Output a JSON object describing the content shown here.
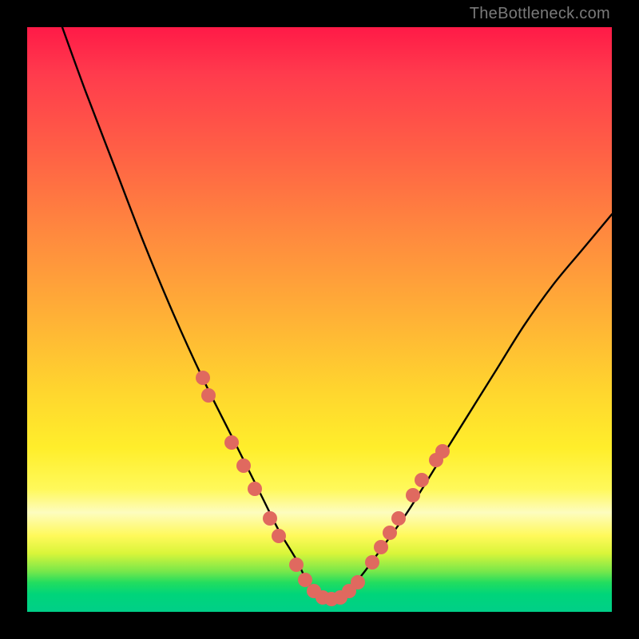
{
  "attribution": "TheBottleneck.com",
  "colors": {
    "frame": "#000000",
    "curve": "#000000",
    "marker": "#e0695f",
    "attribution_text": "#7a7a7a"
  },
  "chart_data": {
    "type": "line",
    "title": "",
    "xlabel": "",
    "ylabel": "",
    "xlim": [
      0,
      100
    ],
    "ylim": [
      0,
      100
    ],
    "grid": false,
    "legend": false,
    "note": "No axis ticks or labels are rendered; values are fractional positions (0–100) estimated from the plot geometry.",
    "series": [
      {
        "name": "bottleneck-curve",
        "x": [
          6,
          10,
          15,
          20,
          25,
          30,
          35,
          40,
          43,
          46,
          48,
          50,
          52,
          54,
          57,
          60,
          65,
          70,
          75,
          80,
          85,
          90,
          95,
          100
        ],
        "y": [
          100,
          89,
          76,
          63,
          51,
          40,
          30,
          20,
          14,
          9,
          5,
          3,
          2,
          3,
          6,
          10,
          17,
          25,
          33,
          41,
          49,
          56,
          62,
          68
        ]
      }
    ],
    "markers": [
      {
        "x": 30.0,
        "y": 40.0
      },
      {
        "x": 31.0,
        "y": 37.0
      },
      {
        "x": 35.0,
        "y": 29.0
      },
      {
        "x": 37.0,
        "y": 25.0
      },
      {
        "x": 39.0,
        "y": 21.0
      },
      {
        "x": 41.5,
        "y": 16.0
      },
      {
        "x": 43.0,
        "y": 13.0
      },
      {
        "x": 46.0,
        "y": 8.0
      },
      {
        "x": 47.5,
        "y": 5.5
      },
      {
        "x": 49.0,
        "y": 3.5
      },
      {
        "x": 50.5,
        "y": 2.5
      },
      {
        "x": 52.0,
        "y": 2.2
      },
      {
        "x": 53.5,
        "y": 2.5
      },
      {
        "x": 55.0,
        "y": 3.5
      },
      {
        "x": 56.5,
        "y": 5.0
      },
      {
        "x": 59.0,
        "y": 8.5
      },
      {
        "x": 60.5,
        "y": 11.0
      },
      {
        "x": 62.0,
        "y": 13.5
      },
      {
        "x": 63.5,
        "y": 16.0
      },
      {
        "x": 66.0,
        "y": 20.0
      },
      {
        "x": 67.5,
        "y": 22.5
      },
      {
        "x": 70.0,
        "y": 26.0
      },
      {
        "x": 71.0,
        "y": 27.5
      }
    ]
  }
}
